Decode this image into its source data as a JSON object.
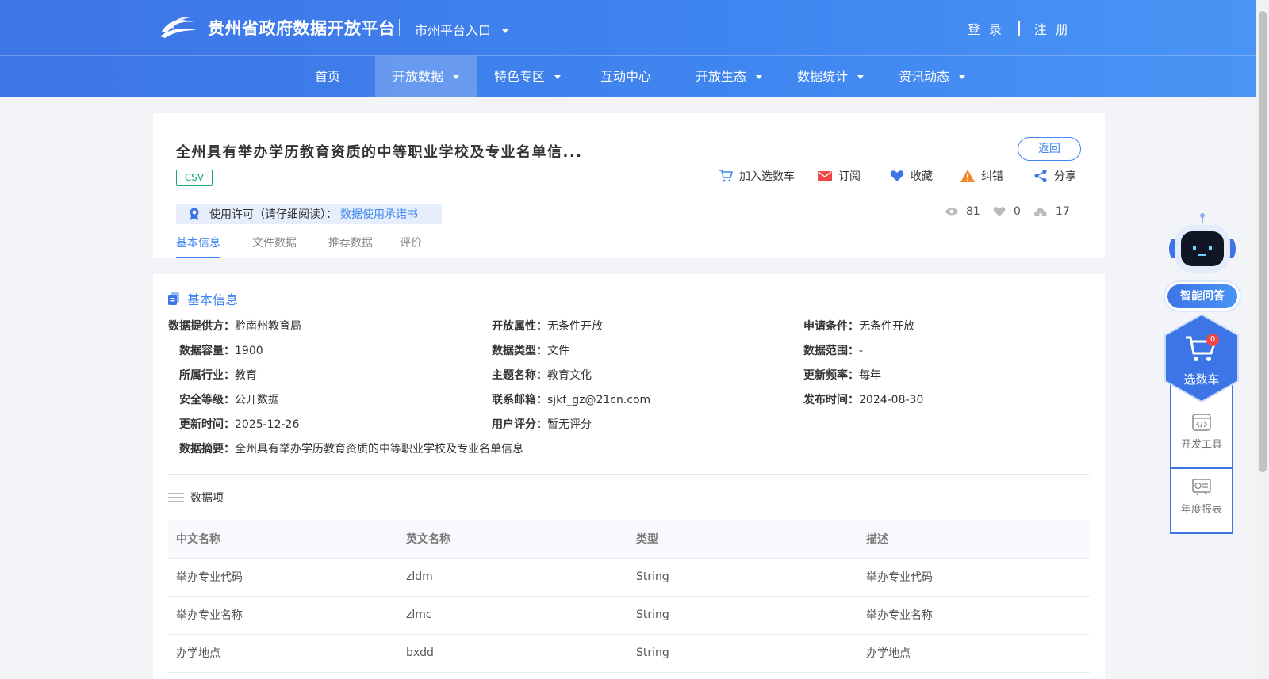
{
  "header": {
    "site_title": "贵州省政府数据开放平台",
    "city_entry": "市州平台入口",
    "login": "登 录",
    "register": "注 册"
  },
  "nav": {
    "items": [
      {
        "label": "首页",
        "has_dropdown": false,
        "active": false
      },
      {
        "label": "开放数据",
        "has_dropdown": true,
        "active": true
      },
      {
        "label": "特色专区",
        "has_dropdown": true,
        "active": false
      },
      {
        "label": "互动中心",
        "has_dropdown": false,
        "active": false
      },
      {
        "label": "开放生态",
        "has_dropdown": true,
        "active": false
      },
      {
        "label": "数据统计",
        "has_dropdown": true,
        "active": false
      },
      {
        "label": "资讯动态",
        "has_dropdown": true,
        "active": false
      }
    ]
  },
  "dataset": {
    "title": "全州具有举办学历教育资质的中等职业学校及专业名单信...",
    "back": "返回",
    "format_tag": "CSV",
    "actions": {
      "cart": "加入选数车",
      "subscribe": "订阅",
      "favorite": "收藏",
      "report": "纠错",
      "share": "分享"
    },
    "license_label": "使用许可（请仔细阅读）：",
    "license_link": "数据使用承诺书",
    "stats": {
      "views": "81",
      "likes": "0",
      "downloads": "17"
    },
    "tabs": [
      "基本信息",
      "文件数据",
      "推荐数据",
      "评价"
    ]
  },
  "basic_info": {
    "section_title": "基本信息",
    "provider_label": "数据提供方：",
    "provider": "黔南州教育局",
    "open_attr_label": "开放属性：",
    "open_attr": "无条件开放",
    "apply_cond_label": "申请条件：",
    "apply_cond": "无条件开放",
    "capacity_label": "数据容量：",
    "capacity": "1900",
    "data_type_label": "数据类型：",
    "data_type": "文件",
    "scope_label": "数据范围：",
    "scope": "-",
    "industry_label": "所属行业：",
    "industry": "教育",
    "topic_label": "主题名称：",
    "topic": "教育文化",
    "frequency_label": "更新频率：",
    "frequency": "每年",
    "security_label": "安全等级：",
    "security": "公开数据",
    "email_label": "联系邮箱：",
    "email": "sjkf_gz@21cn.com",
    "publish_label": "发布时间：",
    "publish": "2024-08-30",
    "updated_label": "更新时间：",
    "updated": "2025-12-26",
    "rating_label": "用户评分：",
    "rating": "暂无评分",
    "summary_label": "数据摘要：",
    "summary": "全州具有举办学历教育资质的中等职业学校及专业名单信息"
  },
  "data_items": {
    "title": "数据项",
    "columns": [
      "中文名称",
      "英文名称",
      "类型",
      "描述"
    ],
    "rows": [
      [
        "举办专业代码",
        "zldm",
        "String",
        "举办专业代码"
      ],
      [
        "举办专业名称",
        "zlmc",
        "String",
        "举办专业名称"
      ],
      [
        "办学地点",
        "bxdd",
        "String",
        "办学地点"
      ]
    ]
  },
  "float_panel": {
    "ai_label": "智能问答",
    "cart_label": "选数车",
    "cart_count": "0",
    "dev_tools": "开发工具",
    "annual_report": "年度报表"
  },
  "colors": {
    "primary": "#3f86f0",
    "tag_green": "#19a96b",
    "badge_red": "#f24545"
  }
}
